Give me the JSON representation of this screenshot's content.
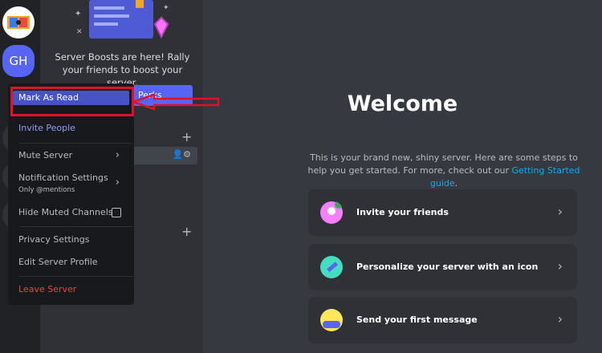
{
  "rail": {
    "server_initials": "GH"
  },
  "boost": {
    "text": "Server Boosts are here! Rally your friends to boost your server.",
    "button_label": "Perks"
  },
  "menu": {
    "items": [
      {
        "label": "Mark As Read"
      },
      {
        "label": "Invite People"
      },
      {
        "label": "Mute Server"
      },
      {
        "label": "Notification Settings",
        "sublabel": "Only @mentions"
      },
      {
        "label": "Hide Muted Channels"
      },
      {
        "label": "Privacy Settings"
      },
      {
        "label": "Edit Server Profile"
      },
      {
        "label": "Leave Server"
      }
    ]
  },
  "main": {
    "title": "Welcome",
    "intro": "This is your brand new, shiny server. Here are some steps to help you get started. For more, check out our",
    "intro_link": "Getting Started guide",
    "intro_end": ".",
    "cards": [
      {
        "label": "Invite your friends"
      },
      {
        "label": "Personalize your server with an icon"
      },
      {
        "label": "Send your first message"
      }
    ]
  },
  "colors": {
    "accent": "#5865f2",
    "danger": "#ed4245",
    "link": "#00aff4",
    "highlight_annotation": "#e0112b"
  }
}
